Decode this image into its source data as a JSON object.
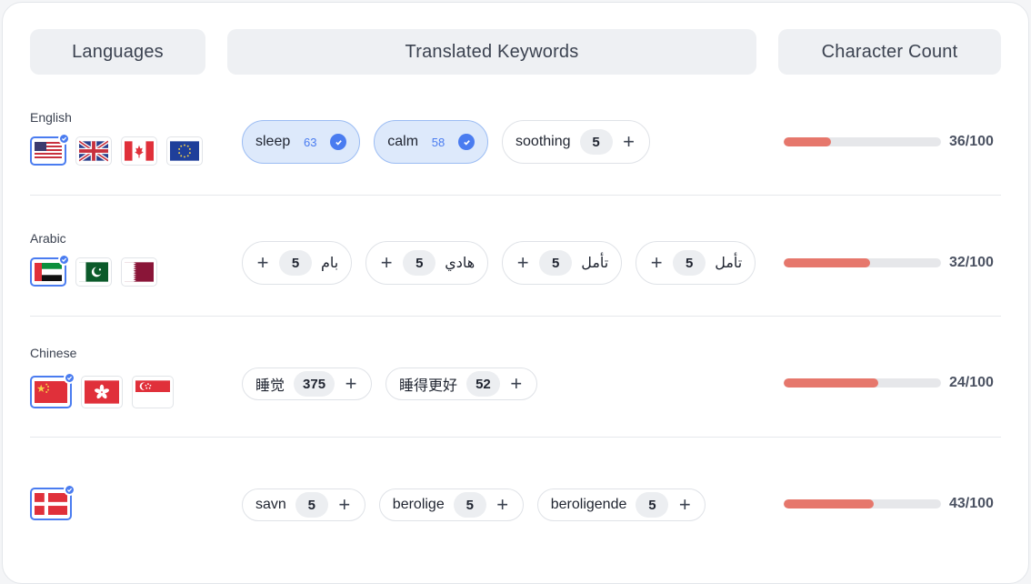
{
  "headers": {
    "languages": "Languages",
    "keywords": "Translated Keywords",
    "count": "Character Count"
  },
  "accent_color": "#4a7cf0",
  "bar_color": "#e6776c",
  "rows": [
    {
      "language": "English",
      "flags": [
        "us-flag-icon (selected)",
        "uk-flag-icon",
        "canada-flag-icon",
        "eu-flag-icon"
      ],
      "keywords": [
        {
          "text": "sleep",
          "num": "63",
          "selected": true
        },
        {
          "text": "calm",
          "num": "58",
          "selected": true
        },
        {
          "text": "soothing",
          "num": "5",
          "selected": false
        }
      ],
      "count": "36/100",
      "fill": 0.3
    },
    {
      "language": "Arabic",
      "flags": [
        "uae-flag-icon (selected)",
        "pakistan-flag-icon",
        "qatar-flag-icon"
      ],
      "keywords": [
        {
          "text": "بام",
          "num": "5",
          "selected": false
        },
        {
          "text": "هادي",
          "num": "5",
          "selected": false
        },
        {
          "text": "تأمل",
          "num": "5",
          "selected": false
        },
        {
          "text": "تأمل",
          "num": "5",
          "selected": false
        }
      ],
      "count": "32/100",
      "fill": 0.55
    },
    {
      "language": "Chinese",
      "flags": [
        "china-flag-icon (selected)",
        "hong-kong-flag-icon",
        "singapore-flag-icon"
      ],
      "keywords": [
        {
          "text": "睡觉",
          "num": "375",
          "selected": false
        },
        {
          "text": "睡得更好",
          "num": "52",
          "selected": false
        }
      ],
      "count": "24/100",
      "fill": 0.6
    },
    {
      "language": "",
      "flags": [
        "denmark-flag-icon (selected)"
      ],
      "keywords": [
        {
          "text": "savn",
          "num": "5",
          "selected": false
        },
        {
          "text": "berolige",
          "num": "5",
          "selected": false
        },
        {
          "text": "beroligende",
          "num": "5",
          "selected": false
        }
      ],
      "count": "43/100",
      "fill": 0.57
    }
  ]
}
